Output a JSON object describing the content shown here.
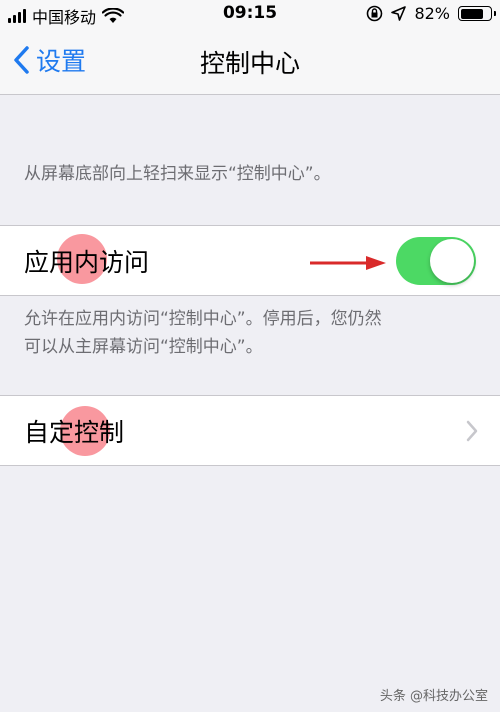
{
  "status_bar": {
    "carrier": "中国移动",
    "time": "09:15",
    "battery": "82%",
    "battery_level": 0.82,
    "icons": [
      "signal-bars-icon",
      "wifi-icon",
      "orientation-lock-icon",
      "location-icon",
      "battery-icon"
    ]
  },
  "nav": {
    "back_label": "设置",
    "title": "控制中心"
  },
  "sections": {
    "swipe_hint": "从屏幕底部向上轻扫来显示“控制中心”。",
    "in_app_access": {
      "label": "应用内访问",
      "enabled": true,
      "description_line1": "允许在应用内访问“控制中心”。停用后，您仍然",
      "description_line2": "可以从主屏幕访问“控制中心”。"
    },
    "customize": {
      "label": "自定控制"
    }
  },
  "watermark": "头条 @科技办公室",
  "colors": {
    "accent": "#1f7aef",
    "toggle_on": "#4cd964",
    "background": "#efeff4",
    "annotation_red": "#d92a2a"
  }
}
